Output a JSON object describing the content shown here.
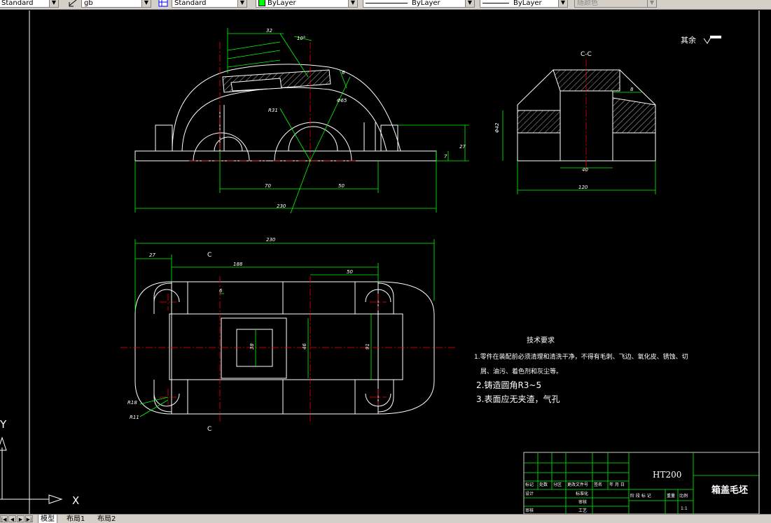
{
  "toolbar": {
    "text_style": "Standard",
    "dim_style": "gb",
    "table_style": "Standard",
    "layer_color": "ByLayer",
    "linetype": "ByLayer",
    "lineweight": "ByLayer",
    "plot_style": "随颜色"
  },
  "drawing": {
    "section_label": "C-C",
    "roughness_note": "其余",
    "cut_label_c": "C",
    "dims": {
      "d32": "32",
      "d10deg": "10°",
      "d6": "6",
      "d8_top": "8",
      "r31": "R31",
      "phi65": "Φ65",
      "d27_front": "27",
      "d7_front": "7",
      "d70": "70",
      "d50_front": "50",
      "d230_front": "230",
      "d8_side": "8",
      "phi42": "Φ42",
      "d40_side": "40",
      "d120_side": "120",
      "d230_plan": "230",
      "d27_plan": "27",
      "d188": "188",
      "d50_plan": "50",
      "d6_plan": "6",
      "d38": "38",
      "d46": "46",
      "d91": "91",
      "r18": "R18",
      "r11": "R11"
    },
    "notes": {
      "title": "技术要求",
      "n1_l1": "1.零件在装配前必须清理和清洗干净，不得有毛刺、飞边、氧化皮、锈蚀、切",
      "n1_l2": "屑、油污、着色剂和灰尘等。",
      "n2": "2.铸造圆角R3~5",
      "n3": "3.表面应无夹渣，气孔"
    },
    "title_block": {
      "material": "HT200",
      "part_name": "箱盖毛坯",
      "hdr_mark": "标记",
      "hdr_count": "处数",
      "hdr_zone": "分区",
      "hdr_doc": "更改文件号",
      "hdr_sign": "签名",
      "hdr_date": "年 月 日",
      "design": "设计",
      "standard": "标准化",
      "check": "审核",
      "craft": "工艺",
      "stage": "阶 段 标 记",
      "weight": "重量",
      "scale": "比例",
      "scale_val": "1:1",
      "review": "审核"
    },
    "ucs_x": "X",
    "ucs_y": "Y"
  },
  "tabs": [
    {
      "label": "模型"
    },
    {
      "label": "布局1"
    },
    {
      "label": "布局2"
    }
  ],
  "colors": {
    "background": "#000000",
    "geometry": "#ffffff",
    "dimension": "#00ff00",
    "centerline": "#ff0000",
    "text": "#ffffff"
  }
}
